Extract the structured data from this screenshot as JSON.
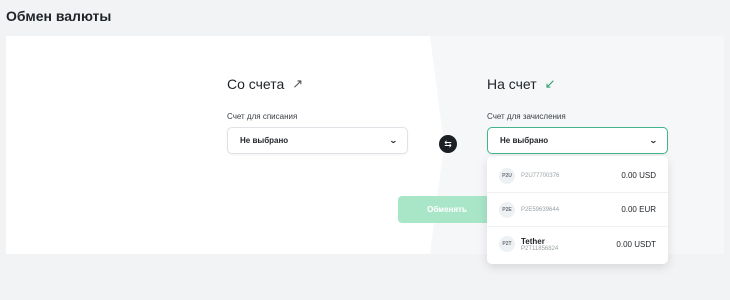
{
  "page": {
    "title": "Обмен валюты"
  },
  "from": {
    "title": "Со счета",
    "arrow": "↗",
    "label": "Счет для списания",
    "value": "Не выбрано"
  },
  "to": {
    "title": "На счет",
    "arrow": "↙",
    "label": "Счет для зачисления",
    "value": "Не выбрано"
  },
  "swap_icon": "⇆",
  "exchange_button": "Обменять",
  "dropdown": {
    "items": [
      {
        "badge": "P2U",
        "name": "",
        "account": "P2U77700376",
        "amount": "0.00 USD"
      },
      {
        "badge": "P2E",
        "name": "",
        "account": "P2E59639644",
        "amount": "0.00 EUR"
      },
      {
        "badge": "P2T",
        "name": "Tether",
        "account": "P2T11856824",
        "amount": "0.00 USDT"
      }
    ]
  }
}
